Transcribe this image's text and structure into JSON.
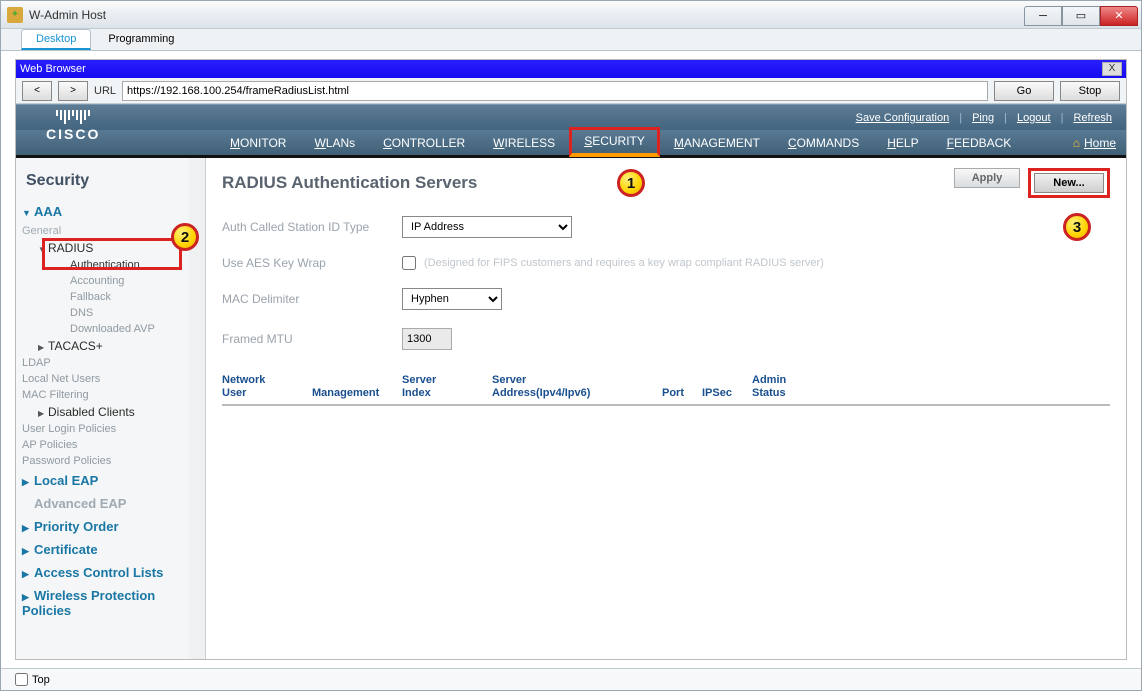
{
  "window": {
    "title": "W-Admin Host"
  },
  "apptabs": {
    "desktop": "Desktop",
    "programming": "Programming"
  },
  "browser": {
    "title": "Web Browser",
    "urlLabel": "URL",
    "url": "https://192.168.100.254/frameRadiusList.html",
    "go": "Go",
    "stop": "Stop"
  },
  "header": {
    "save": "Save Configuration",
    "ping": "Ping",
    "logout": "Logout",
    "refresh": "Refresh",
    "logoText": "CISCO",
    "nav": {
      "monitor": "ONITOR",
      "wlans": "LANs",
      "controller": "ONTROLLER",
      "wireless": "IRELESS",
      "security": "ECURITY",
      "management": "ANAGEMENT",
      "commands": "OMMANDS",
      "help": "ELP",
      "feedback": "EEDBACK"
    },
    "navFirst": {
      "monitor": "M",
      "wlans": "W",
      "controller": "C",
      "wireless": "W",
      "security": "S",
      "management": "M",
      "commands": "C",
      "help": "H",
      "feedback": "F"
    },
    "home": "Home"
  },
  "sidebar": {
    "title": "Security",
    "aaa": "AAA",
    "general": "General",
    "radius": "RADIUS",
    "auth": "Authentication",
    "acct": "Accounting",
    "fallback": "Fallback",
    "dns": "DNS",
    "dlavp": "Downloaded AVP",
    "tacacs": "TACACS+",
    "ldap": "LDAP",
    "lnu": "Local Net Users",
    "macf": "MAC Filtering",
    "disabled": "Disabled Clients",
    "ulp": "User Login Policies",
    "app": "AP Policies",
    "pwp": "Password Policies",
    "localeap": "Local EAP",
    "adveap": "Advanced EAP",
    "priority": "Priority Order",
    "cert": "Certificate",
    "acl": "Access Control Lists",
    "wpp": "Wireless Protection Policies"
  },
  "content": {
    "title": "RADIUS Authentication Servers",
    "apply": "Apply",
    "new": "New...",
    "form": {
      "stationLabel": "Auth Called Station ID Type",
      "stationValue": "IP Address",
      "aesLabel": "Use AES Key Wrap",
      "aesNote": "(Designed for FIPS customers and requires a key wrap compliant RADIUS server)",
      "macLabel": "MAC Delimiter",
      "macValue": "Hyphen",
      "mtuLabel": "Framed MTU",
      "mtuValue": "1300"
    },
    "columns": {
      "netuser1": "Network",
      "netuser2": "User",
      "mgmt": "Management",
      "srvidx1": "Server",
      "srvidx2": "Index",
      "srvaddr1": "Server",
      "srvaddr2": "Address(Ipv4/Ipv6)",
      "port": "Port",
      "ipsec": "IPSec",
      "admin1": "Admin",
      "admin2": "Status"
    }
  },
  "footer": {
    "top": "Top"
  }
}
